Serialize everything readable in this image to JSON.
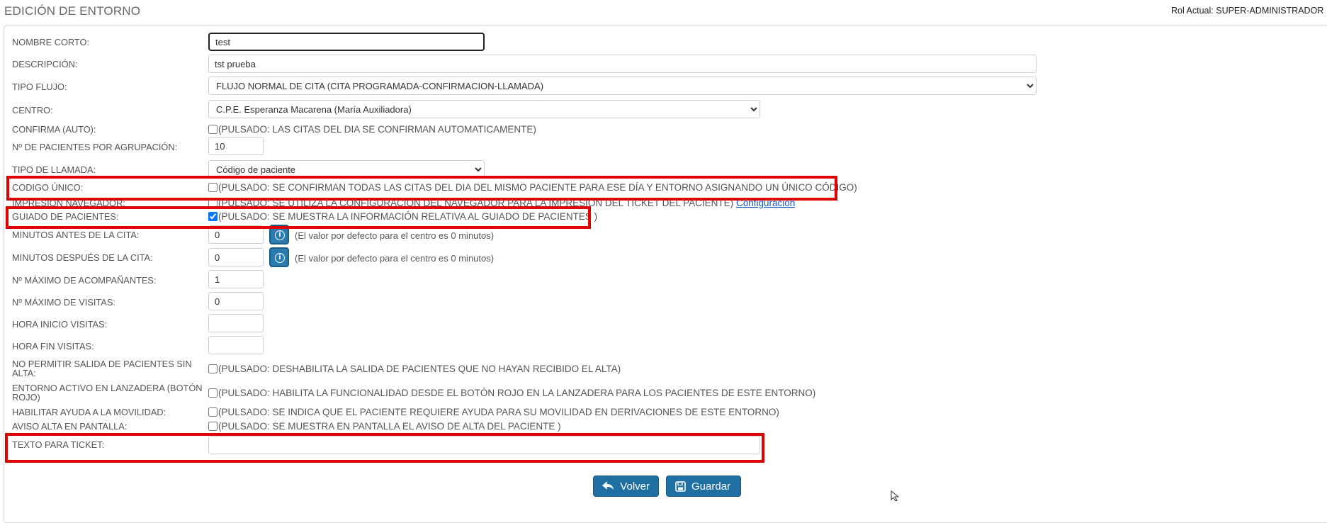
{
  "header": {
    "title": "EDICIÓN DE ENTORNO",
    "role": "Rol Actual: SUPER-ADMINISTRADOR"
  },
  "form": {
    "nombre_corto": {
      "label": "NOMBRE CORTO:",
      "value": "test"
    },
    "descripcion": {
      "label": "DESCRIPCIÓN:",
      "value": "tst prueba"
    },
    "tipo_flujo": {
      "label": "TIPO FLUJO:",
      "value": "FLUJO NORMAL DE CITA (CITA PROGRAMADA-CONFIRMACION-LLAMADA)"
    },
    "centro": {
      "label": "CENTRO:",
      "value": "C.P.E. Esperanza Macarena (María Auxiliadora)"
    },
    "confirma_auto": {
      "label": "CONFIRMA (AUTO):",
      "text": "(PULSADO: LAS CITAS DEL DIA SE CONFIRMAN AUTOMATICAMENTE)",
      "checked": false
    },
    "pacientes_agrupacion": {
      "label": "Nº DE PACIENTES POR AGRUPACIÓN:",
      "value": "10"
    },
    "tipo_llamada": {
      "label": "TIPO DE LLAMADA:",
      "value": "Código de paciente"
    },
    "codigo_unico": {
      "label": "CODIGO ÚNICO:",
      "text": "(PULSADO: SE CONFIRMAN TODAS LAS CITAS DEL DIA DEL MISMO PACIENTE PARA ESE DÍA Y ENTORNO ASIGNANDO UN ÚNICO CÓDIGO)",
      "checked": false
    },
    "impresion_navegador": {
      "label": "IMPRESIÓN NAVEGADOR:",
      "text": "(PULSADO: SE UTILIZA LA CONFIGURACIÓN DEL NAVEGADOR PARA LA IMPRESIÓN DEL TICKET DEL PACIENTE)",
      "link": "Configuración",
      "checked": false
    },
    "guiado_pacientes": {
      "label": "GUIADO DE PACIENTES:",
      "text": "(PULSADO: SE MUESTRA LA INFORMACIÓN RELATIVA AL GUIADO DE PACIENTES )",
      "checked": true
    },
    "minutos_antes": {
      "label": "MINUTOS ANTES DE LA CITA:",
      "value": "0",
      "hint": "(El valor por defecto para el centro es 0 minutos)"
    },
    "minutos_despues": {
      "label": "MINUTOS DESPUÉS DE LA CITA:",
      "value": "0",
      "hint": "(El valor por defecto para el centro es 0 minutos)"
    },
    "max_acompanantes": {
      "label": "Nº MÁXIMO DE ACOMPAÑANTES:",
      "value": "1"
    },
    "max_visitas": {
      "label": "Nº MÁXIMO DE VISITAS:",
      "value": "0"
    },
    "hora_inicio": {
      "label": "HORA INICIO VISITAS:",
      "value": ""
    },
    "hora_fin": {
      "label": "HORA FIN VISITAS:",
      "value": ""
    },
    "no_permitir_salida": {
      "label": "NO PERMITIR SALIDA DE PACIENTES SIN ALTA:",
      "text": "(PULSADO: DESHABILITA LA SALIDA DE PACIENTES QUE NO HAYAN RECIBIDO EL ALTA)",
      "checked": false
    },
    "entorno_lanzadera": {
      "label": "ENTORNO ACTIVO EN LANZADERA (BOTÓN ROJO)",
      "text": "(PULSADO: HABILITA LA FUNCIONALIDAD DESDE EL BOTÓN ROJO EN LA LANZADERA PARA LOS PACIENTES DE ESTE ENTORNO)",
      "checked": false
    },
    "ayuda_movilidad": {
      "label": "HABILITAR AYUDA A LA MOVILIDAD:",
      "text": "(PULSADO: SE INDICA QUE EL PACIENTE REQUIERE AYUDA PARA SU MOVILIDAD EN DERIVACIONES DE ESTE ENTORNO)",
      "checked": false
    },
    "aviso_alta": {
      "label": "AVISO ALTA EN PANTALLA:",
      "text": "(PULSADO: SE MUESTRA EN PANTALLA EL AVISO DE ALTA DEL PACIENTE )",
      "checked": false
    },
    "texto_ticket": {
      "label": "TEXTO PARA TICKET:",
      "value": ""
    }
  },
  "buttons": {
    "volver": "Volver",
    "guardar": "Guardar"
  },
  "colors": {
    "highlight": "#e00000",
    "button": "#1f6fa3",
    "link": "#1155cc"
  }
}
